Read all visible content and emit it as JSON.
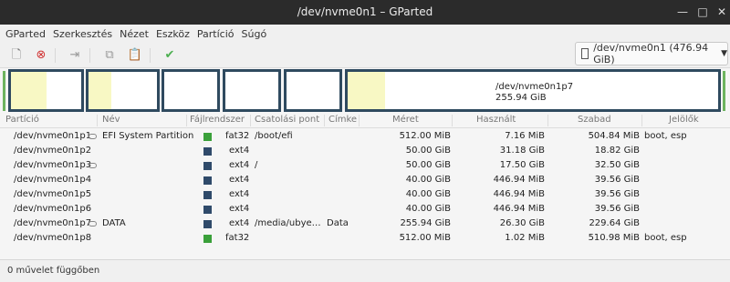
{
  "window": {
    "title": "/dev/nvme0n1 – GParted",
    "minimize": "—",
    "maximize": "□",
    "close": "✕"
  },
  "menu": [
    "GParted",
    "Szerkesztés",
    "Nézet",
    "Eszköz",
    "Partíció",
    "Súgó"
  ],
  "toolbar": {
    "new_icon": "new-partition-icon",
    "delete_icon": "delete-icon",
    "resize_icon": "resize-move-icon",
    "copy_icon": "copy-icon",
    "paste_icon": "paste-icon",
    "apply_icon": "apply-check-icon"
  },
  "device_selector": {
    "label": "/dev/nvme0n1 (476.94 GiB)",
    "arrow": "▼"
  },
  "partition_map": [
    {
      "name": "/dev/nvme0n1p1",
      "used_fraction": 0.5,
      "label1": "",
      "label2": ""
    },
    {
      "name": "/dev/nvme0n1p2",
      "used_fraction": 0.33,
      "label1": "",
      "label2": ""
    },
    {
      "name": "/dev/nvme0n1p3",
      "used_fraction": 0,
      "label1": "",
      "label2": ""
    },
    {
      "name": "/dev/nvme0n1p4",
      "used_fraction": 0,
      "label1": "",
      "label2": ""
    },
    {
      "name": "/dev/nvme0n1p5",
      "used_fraction": 0,
      "label1": "",
      "label2": ""
    },
    {
      "name": "/dev/nvme0n1p7",
      "used_fraction": 0.1,
      "label1": "/dev/nvme0n1p7",
      "label2": "255.94 GiB"
    }
  ],
  "columns": {
    "partition": "Partíció",
    "name": "Név",
    "filesystem": "Fájlrendszer",
    "mountpoint": "Csatolási pont",
    "label": "Címke",
    "size": "Méret",
    "used": "Használt",
    "free": "Szabad",
    "flags": "Jelölők"
  },
  "partitions": [
    {
      "partition": "/dev/nvme0n1p1",
      "locked": true,
      "name": "EFI System Partition",
      "fs": "fat32",
      "fs_color": "#3aa03a",
      "mount": "/boot/efi",
      "label": "",
      "size": "512.00 MiB",
      "used": "7.16 MiB",
      "free": "504.84 MiB",
      "flags": "boot, esp"
    },
    {
      "partition": "/dev/nvme0n1p2",
      "locked": false,
      "name": "",
      "fs": "ext4",
      "fs_color": "#2f4a6a",
      "mount": "",
      "label": "",
      "size": "50.00 GiB",
      "used": "31.18 GiB",
      "free": "18.82 GiB",
      "flags": ""
    },
    {
      "partition": "/dev/nvme0n1p3",
      "locked": true,
      "name": "",
      "fs": "ext4",
      "fs_color": "#2f4a6a",
      "mount": "/",
      "label": "",
      "size": "50.00 GiB",
      "used": "17.50 GiB",
      "free": "32.50 GiB",
      "flags": ""
    },
    {
      "partition": "/dev/nvme0n1p4",
      "locked": false,
      "name": "",
      "fs": "ext4",
      "fs_color": "#2f4a6a",
      "mount": "",
      "label": "",
      "size": "40.00 GiB",
      "used": "446.94 MiB",
      "free": "39.56 GiB",
      "flags": ""
    },
    {
      "partition": "/dev/nvme0n1p5",
      "locked": false,
      "name": "",
      "fs": "ext4",
      "fs_color": "#2f4a6a",
      "mount": "",
      "label": "",
      "size": "40.00 GiB",
      "used": "446.94 MiB",
      "free": "39.56 GiB",
      "flags": ""
    },
    {
      "partition": "/dev/nvme0n1p6",
      "locked": false,
      "name": "",
      "fs": "ext4",
      "fs_color": "#2f4a6a",
      "mount": "",
      "label": "",
      "size": "40.00 GiB",
      "used": "446.94 MiB",
      "free": "39.56 GiB",
      "flags": ""
    },
    {
      "partition": "/dev/nvme0n1p7",
      "locked": true,
      "name": "DATA",
      "fs": "ext4",
      "fs_color": "#2f4a6a",
      "mount": "/media/ubye…",
      "label": "Data",
      "size": "255.94 GiB",
      "used": "26.30 GiB",
      "free": "229.64 GiB",
      "flags": ""
    },
    {
      "partition": "/dev/nvme0n1p8",
      "locked": false,
      "name": "",
      "fs": "fat32",
      "fs_color": "#3aa03a",
      "mount": "",
      "label": "",
      "size": "512.00 MiB",
      "used": "1.02 MiB",
      "free": "510.98 MiB",
      "flags": "boot, esp"
    }
  ],
  "status": "0 művelet függőben"
}
